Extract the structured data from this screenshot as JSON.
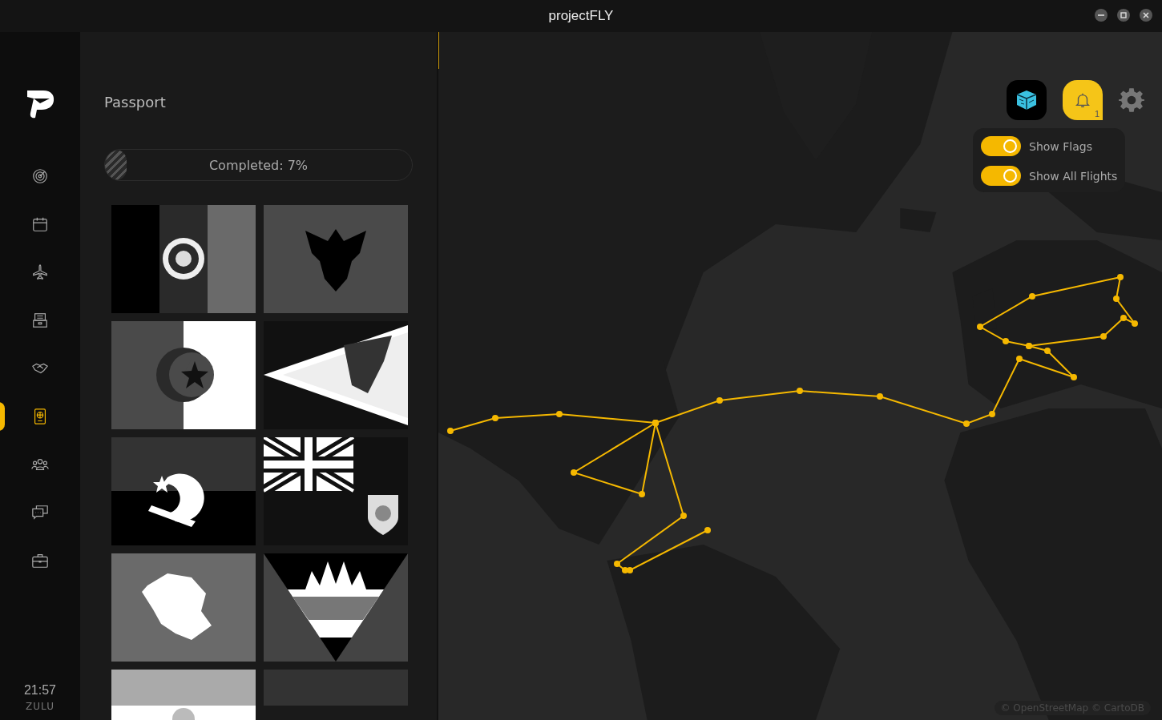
{
  "window": {
    "title": "project**FLY**"
  },
  "sidebar": {
    "items": [
      {
        "kind": "radar",
        "selected": false
      },
      {
        "kind": "calendar",
        "selected": false
      },
      {
        "kind": "plane",
        "selected": false
      },
      {
        "kind": "archive",
        "selected": false
      },
      {
        "kind": "handshake",
        "selected": false
      },
      {
        "kind": "passport",
        "selected": true
      },
      {
        "kind": "people",
        "selected": false
      },
      {
        "kind": "chat",
        "selected": false
      },
      {
        "kind": "briefcase",
        "selected": false
      }
    ],
    "time": "21:57",
    "timezone": "ZULU"
  },
  "passport": {
    "title": "Passport",
    "progress": {
      "label": "Completed: 7%",
      "level": 0.07
    },
    "flags": [
      {
        "kind": "triband"
      },
      {
        "kind": "eagle"
      },
      {
        "kind": "crescent"
      },
      {
        "kind": "pennant"
      },
      {
        "kind": "cog"
      },
      {
        "kind": "ensign"
      },
      {
        "kind": "island"
      },
      {
        "kind": "sunrise"
      },
      {
        "kind": "sunband"
      },
      {
        "kind": "plain"
      }
    ]
  },
  "map": {
    "notifications": {
      "count": "1"
    },
    "toggles": [
      {
        "label": "Show Flags",
        "on": true
      },
      {
        "label": "Show All Flights",
        "on": true
      }
    ],
    "attribution": "© OpenStreetMap © CartoDB"
  }
}
